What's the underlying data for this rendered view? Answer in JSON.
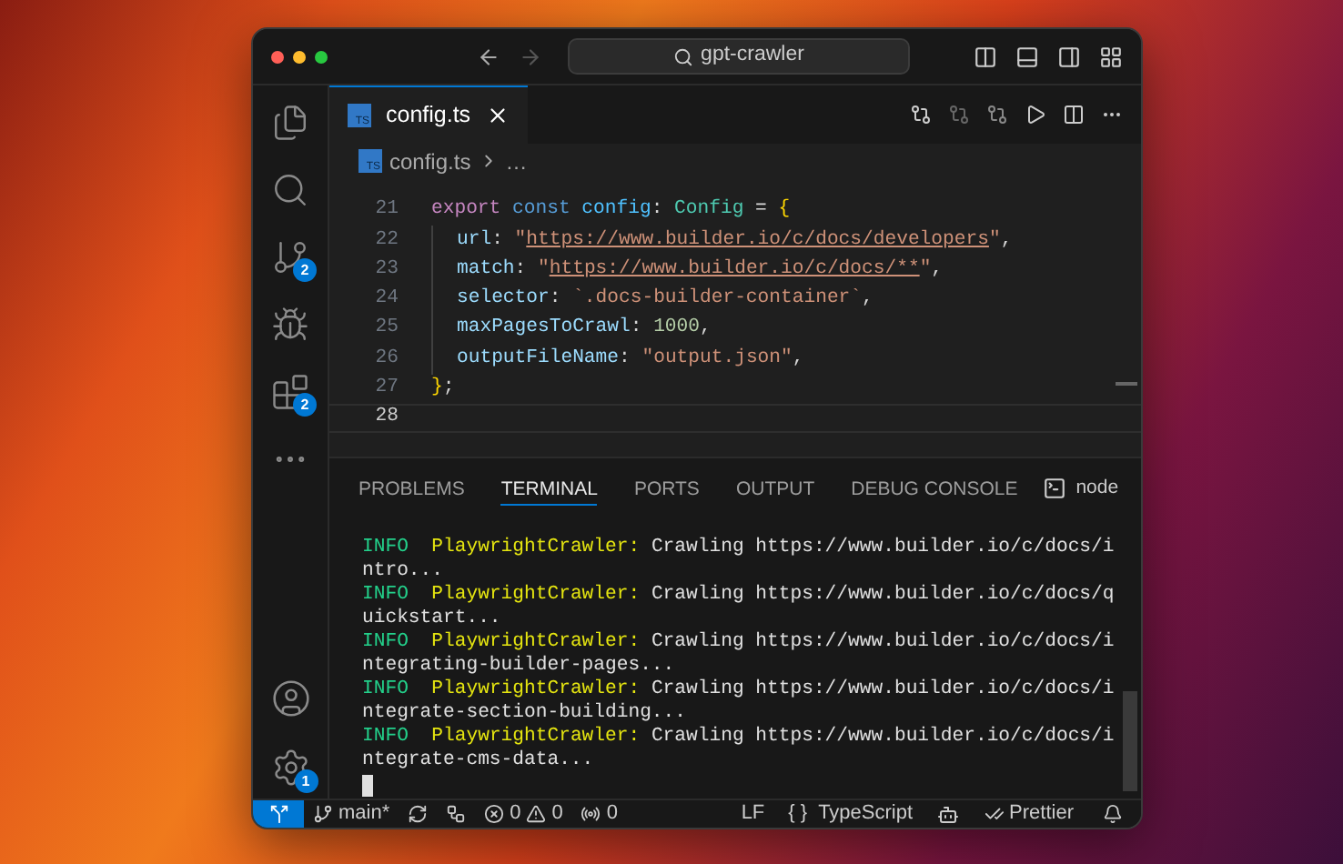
{
  "title_bar": {
    "search": "gpt-crawler"
  },
  "activity_bar": {
    "items": [
      {
        "kind": "explorer"
      },
      {
        "kind": "search"
      },
      {
        "kind": "source_control",
        "badge": "2"
      },
      {
        "kind": "run"
      },
      {
        "kind": "extensions",
        "badge": "2"
      },
      {
        "kind": "more"
      }
    ],
    "bottom": [
      {
        "kind": "account"
      },
      {
        "kind": "manage",
        "badge": "1"
      }
    ]
  },
  "editor_tabs": [
    {
      "label": "config.ts",
      "file_type": "TS",
      "selected": true
    }
  ],
  "breadcrumbs": {
    "file": "config.ts",
    "file_type": "TS",
    "rest": "…"
  },
  "editor": {
    "lines": [
      {
        "number": "21",
        "indent": false,
        "current": false,
        "tokens": [
          {
            "text": "export ",
            "kind": "keyword"
          },
          {
            "text": "const ",
            "kind": "storage"
          },
          {
            "text": "config",
            "kind": "variable"
          },
          {
            "text": ": ",
            "kind": "plain"
          },
          {
            "text": "Config",
            "kind": "type"
          },
          {
            "text": " = ",
            "kind": "plain"
          },
          {
            "text": "{",
            "kind": "brace"
          }
        ]
      },
      {
        "number": "22",
        "indent": true,
        "current": false,
        "tokens": [
          {
            "text": "url",
            "kind": "property"
          },
          {
            "text": ": ",
            "kind": "plain"
          },
          {
            "text": "\"",
            "kind": "string"
          },
          {
            "text": "https://www.builder.io/c/docs/developers",
            "kind": "link"
          },
          {
            "text": "\"",
            "kind": "string"
          },
          {
            "text": ",",
            "kind": "plain"
          }
        ]
      },
      {
        "number": "23",
        "indent": true,
        "current": false,
        "tokens": [
          {
            "text": "match",
            "kind": "property"
          },
          {
            "text": ": ",
            "kind": "plain"
          },
          {
            "text": "\"",
            "kind": "string"
          },
          {
            "text": "https://www.builder.io/c/docs/**",
            "kind": "link"
          },
          {
            "text": "\"",
            "kind": "string"
          },
          {
            "text": ",",
            "kind": "plain"
          }
        ]
      },
      {
        "number": "24",
        "indent": true,
        "current": false,
        "tokens": [
          {
            "text": "selector",
            "kind": "property"
          },
          {
            "text": ": ",
            "kind": "plain"
          },
          {
            "text": "`.docs-builder-container`",
            "kind": "string"
          },
          {
            "text": ",",
            "kind": "plain"
          }
        ]
      },
      {
        "number": "25",
        "indent": true,
        "current": false,
        "tokens": [
          {
            "text": "maxPagesToCrawl",
            "kind": "property"
          },
          {
            "text": ": ",
            "kind": "plain"
          },
          {
            "text": "1000",
            "kind": "number"
          },
          {
            "text": ",",
            "kind": "plain"
          }
        ]
      },
      {
        "number": "26",
        "indent": true,
        "current": false,
        "tokens": [
          {
            "text": "outputFileName",
            "kind": "property"
          },
          {
            "text": ": ",
            "kind": "plain"
          },
          {
            "text": "\"output.json\"",
            "kind": "string"
          },
          {
            "text": ",",
            "kind": "plain"
          }
        ]
      },
      {
        "number": "27",
        "indent": false,
        "current": false,
        "tokens": [
          {
            "text": "}",
            "kind": "brace"
          },
          {
            "text": ";",
            "kind": "plain"
          }
        ]
      },
      {
        "number": "28",
        "indent": false,
        "current": true
      }
    ]
  },
  "panel": {
    "tabs": [
      {
        "label": "PROBLEMS",
        "selected": false
      },
      {
        "label": "TERMINAL",
        "selected": true
      },
      {
        "label": "PORTS",
        "selected": false
      },
      {
        "label": "OUTPUT",
        "selected": false
      },
      {
        "label": "DEBUG CONSOLE",
        "selected": false
      }
    ],
    "terminal_name": "node",
    "terminal_lines": [
      {
        "level": "INFO",
        "source": "PlaywrightCrawler:",
        "message": "Crawling https://www.builder.io/c/docs/intro..."
      },
      {
        "level": "INFO",
        "source": "PlaywrightCrawler:",
        "message": "Crawling https://www.builder.io/c/docs/quickstart..."
      },
      {
        "level": "INFO",
        "source": "PlaywrightCrawler:",
        "message": "Crawling https://www.builder.io/c/docs/integrating-builder-pages..."
      },
      {
        "level": "INFO",
        "source": "PlaywrightCrawler:",
        "message": "Crawling https://www.builder.io/c/docs/integrate-section-building..."
      },
      {
        "level": "INFO",
        "source": "PlaywrightCrawler:",
        "message": "Crawling https://www.builder.io/c/docs/integrate-cms-data..."
      }
    ]
  },
  "status_bar": {
    "items": [
      {
        "kind": "remote"
      },
      {
        "kind": "branch",
        "text": "main*"
      },
      {
        "kind": "sync"
      },
      {
        "kind": "graph"
      },
      {
        "kind": "problems",
        "errors": "0",
        "warnings": "0"
      },
      {
        "kind": "ports",
        "text": "0"
      },
      {
        "kind": "spacer"
      },
      {
        "kind": "text",
        "text": "LF"
      },
      {
        "kind": "language",
        "glyph": "{ }",
        "text": "TypeScript"
      },
      {
        "kind": "copilot"
      },
      {
        "kind": "prettier",
        "text": "Prettier"
      },
      {
        "kind": "bell"
      }
    ]
  }
}
